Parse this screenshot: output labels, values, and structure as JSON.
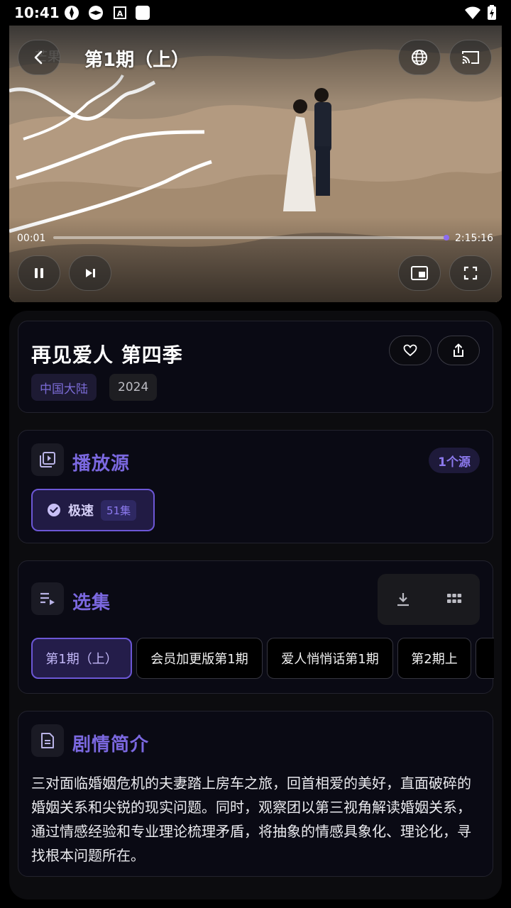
{
  "status_bar": {
    "time": "10:41"
  },
  "player": {
    "title": "第1期（上）",
    "watermark": "芒果",
    "current_time": "00:01",
    "total_time": "2:15:16",
    "progress": 0.0
  },
  "show": {
    "title": "再见爱人 第四季",
    "region": "中国大陆",
    "year": "2024"
  },
  "sources": {
    "heading": "播放源",
    "count_badge": "1个源",
    "items": [
      {
        "label": "极速",
        "episodes": "51集",
        "selected": true
      }
    ]
  },
  "episodes": {
    "heading": "选集",
    "items": [
      {
        "label": "第1期（上）",
        "active": true
      },
      {
        "label": "会员加更版第1期",
        "active": false
      },
      {
        "label": "爱人悄悄话第1期",
        "active": false
      },
      {
        "label": "第2期上",
        "active": false
      }
    ]
  },
  "synopsis": {
    "heading": "剧情简介",
    "text": "三对面临婚姻危机的夫妻踏上房车之旅，回首相爱的美好，直面破碎的婚姻关系和尖锐的现实问题。同时，观察团以第三视角解读婚姻关系，通过情感经验和专业理论梳理矛盾，将抽象的情感具象化、理论化，寻找根本问题所在。"
  },
  "colors": {
    "accent": "#7b68e0",
    "background": "#000000",
    "card": "#0a0a14"
  }
}
